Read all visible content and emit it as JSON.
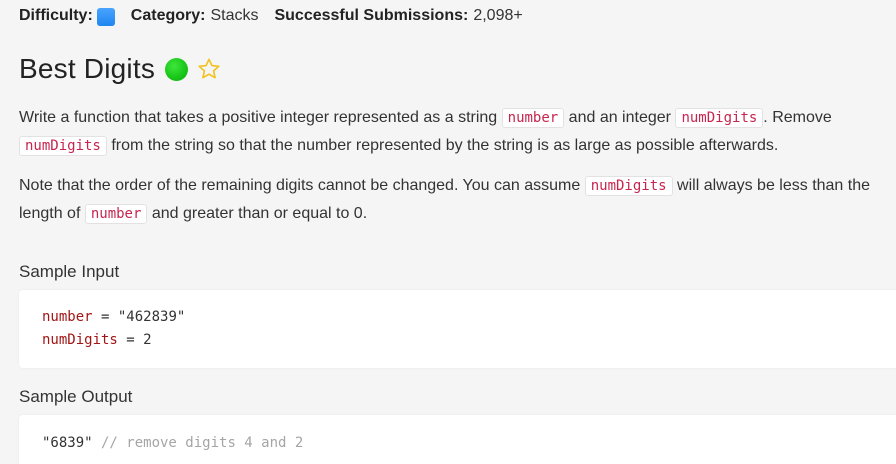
{
  "meta": {
    "difficulty_label": "Difficulty:",
    "category_label": "Category:",
    "category_value": "Stacks",
    "submissions_label": "Successful Submissions:",
    "submissions_value": "2,098+",
    "difficulty_color": "#2b8ef5"
  },
  "question": {
    "title": "Best Digits",
    "completed_color": "#18c418",
    "star_color": "#f2c21b"
  },
  "prompt": {
    "p1_a": "Write a function that takes a positive integer represented as a string",
    "p1_code1": "number",
    "p1_b": "and an integer",
    "p1_code2": "numDigits",
    "p1_c": ". Remove",
    "p1_code3": "numDigits",
    "p1_d": "from the string so that the number represented by the string is as large as possible afterwards.",
    "p2_a": "Note that the order of the remaining digits cannot be changed. You can assume",
    "p2_code1": "numDigits",
    "p2_b": "will always be less than the length of",
    "p2_code2": "number",
    "p2_c": "and greater than or equal to 0."
  },
  "sample_input": {
    "label": "Sample Input",
    "line1_var": "number",
    "line1_op": " = ",
    "line1_val": "\"462839\"",
    "line2_var": "numDigits",
    "line2_op": " = ",
    "line2_val": "2"
  },
  "sample_output": {
    "label": "Sample Output",
    "value": "\"6839\"",
    "comment": " // remove digits 4 and 2"
  }
}
